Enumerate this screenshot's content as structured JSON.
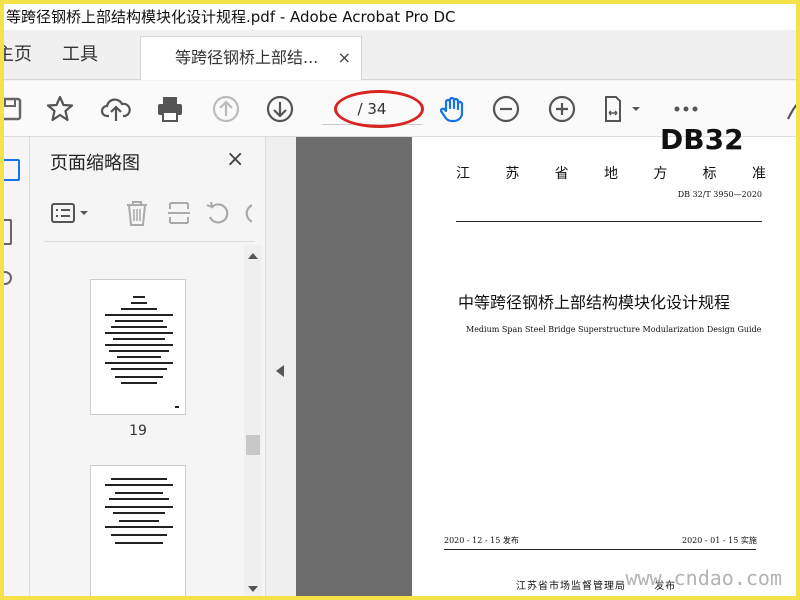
{
  "window": {
    "title": "等跨径钢桥上部结构模块化设计规程.pdf - Adobe Acrobat Pro DC"
  },
  "tabs": {
    "home": "主页",
    "tools": "工具",
    "document": "等跨径钢桥上部结...",
    "close_symbol": "×"
  },
  "toolbar": {
    "page_indicator": "/ 34",
    "icons": [
      "save-icon",
      "bookmark-star-icon",
      "upload-icon",
      "print-icon",
      "page-up-icon",
      "page-down-icon",
      "hand-tool-icon",
      "zoom-out-icon",
      "zoom-in-icon",
      "fit-page-icon",
      "more-icon",
      "sign-icon"
    ]
  },
  "panel": {
    "title": "页面缩略图",
    "close_symbol": "×",
    "thumbnails": [
      {
        "label": "19"
      },
      {
        "label": ""
      }
    ]
  },
  "document": {
    "header_code": "DB32",
    "authority_chars": [
      "江",
      "苏",
      "省",
      "地",
      "方",
      "标",
      "准"
    ],
    "std_number": "DB 32/T  3950—2020",
    "title_cn": "中等跨径钢桥上部结构模块化设计规程",
    "title_en": "Medium Span Steel Bridge Superstructure Modularization Design Guide",
    "publish_date": "2020 - 12 - 15 发布",
    "implement_date": "2020 - 01 - 15 实施",
    "issuer": "江苏省市场监督管理局",
    "issuer_suffix": "发布"
  },
  "watermark": "www.cndao.com",
  "colors": {
    "frame": "#f3e24a",
    "highlight_ellipse": "#d9231e",
    "accent_blue": "#1473e6"
  }
}
